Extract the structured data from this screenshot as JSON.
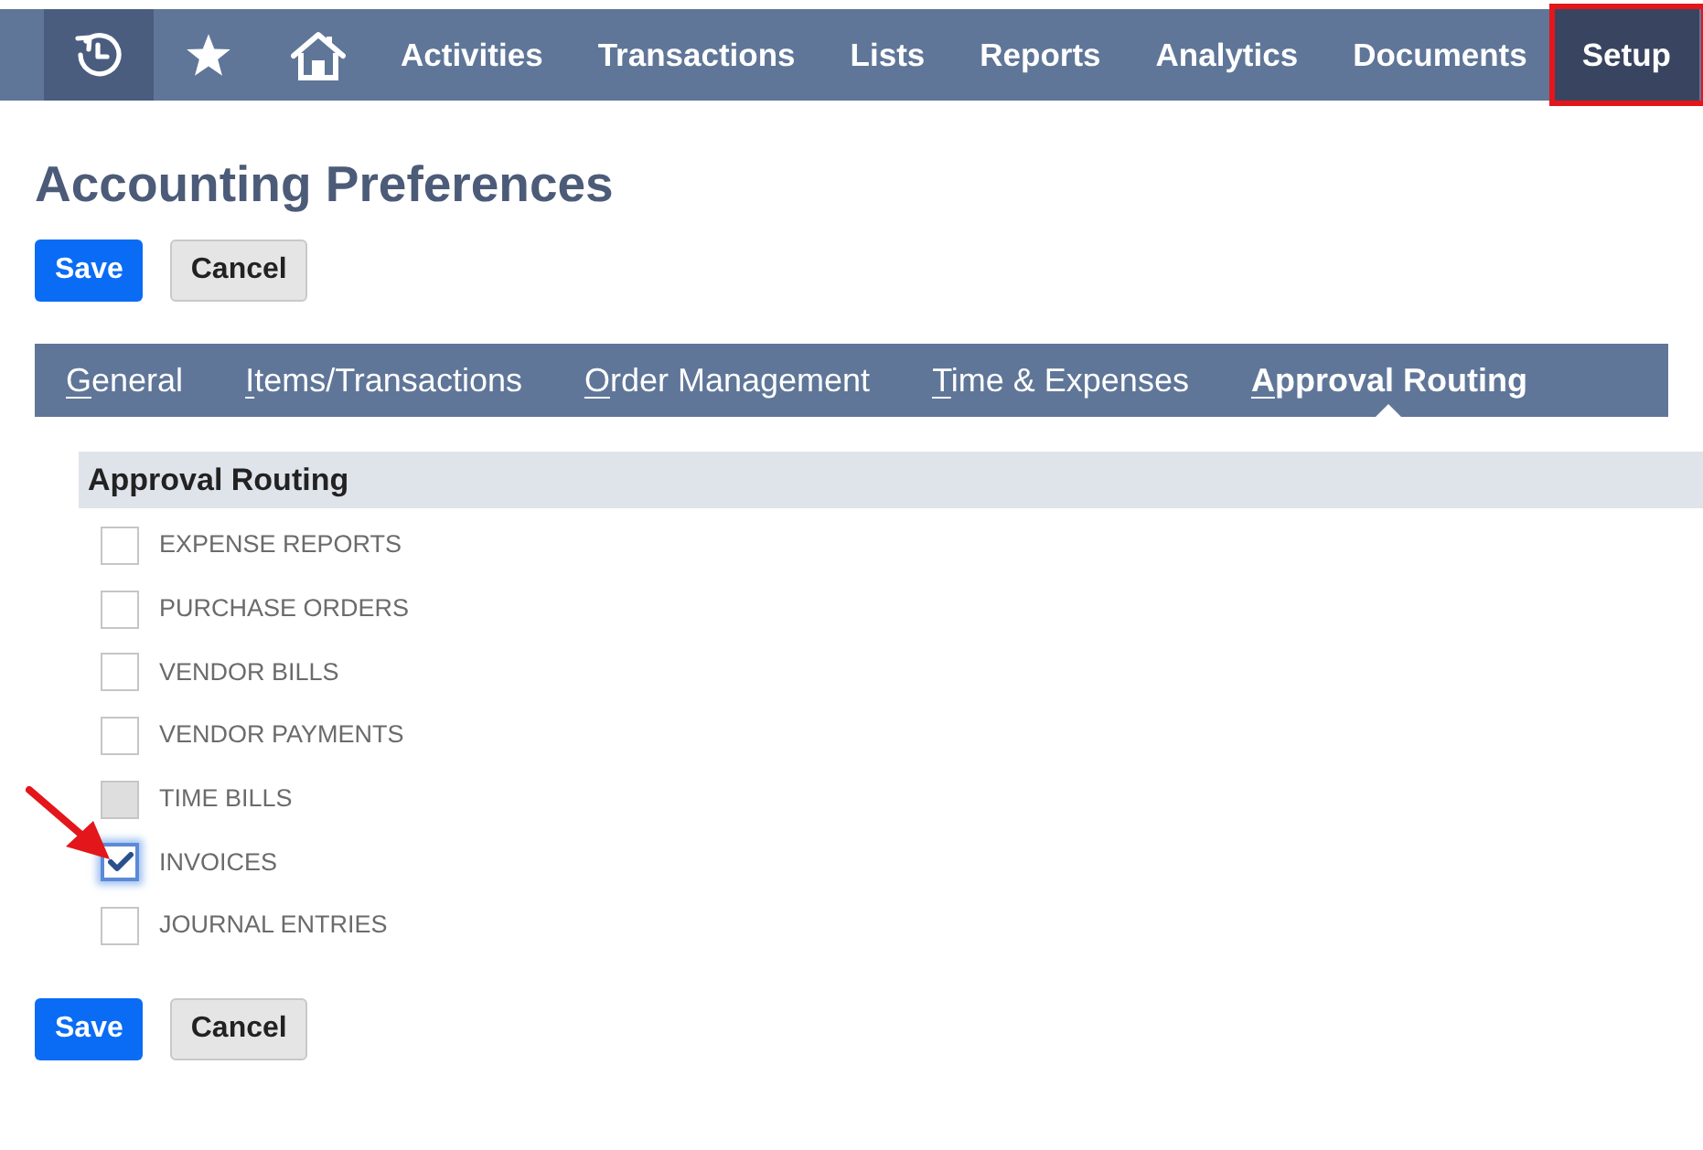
{
  "nav": {
    "items": [
      {
        "label": "Activities",
        "selected": false,
        "highlighted": false
      },
      {
        "label": "Transactions",
        "selected": false,
        "highlighted": false
      },
      {
        "label": "Lists",
        "selected": false,
        "highlighted": false
      },
      {
        "label": "Reports",
        "selected": false,
        "highlighted": false
      },
      {
        "label": "Analytics",
        "selected": false,
        "highlighted": false
      },
      {
        "label": "Documents",
        "selected": false,
        "highlighted": false
      },
      {
        "label": "Setup",
        "selected": true,
        "highlighted": true
      }
    ]
  },
  "page": {
    "title": "Accounting Preferences"
  },
  "top_buttons": [
    {
      "label": "Save",
      "kind": "primary"
    },
    {
      "label": "Cancel",
      "kind": "secondary"
    }
  ],
  "tabs": [
    {
      "label": "General",
      "selected": false
    },
    {
      "label": "Items/Transactions",
      "selected": false
    },
    {
      "label": "Order Management",
      "selected": false
    },
    {
      "label": "Time & Expenses",
      "selected": false
    },
    {
      "label": "Approval Routing",
      "selected": true
    }
  ],
  "section": {
    "title": "Approval Routing",
    "options": [
      {
        "label": "EXPENSE REPORTS",
        "checked": false,
        "disabled": false,
        "focused": false,
        "arrow_marked": false
      },
      {
        "label": "PURCHASE ORDERS",
        "checked": false,
        "disabled": false,
        "focused": false,
        "arrow_marked": false
      },
      {
        "label": "VENDOR BILLS",
        "checked": false,
        "disabled": false,
        "focused": false,
        "arrow_marked": false
      },
      {
        "label": "VENDOR PAYMENTS",
        "checked": false,
        "disabled": false,
        "focused": false,
        "arrow_marked": false
      },
      {
        "label": "TIME BILLS",
        "checked": false,
        "disabled": true,
        "focused": false,
        "arrow_marked": false
      },
      {
        "label": "INVOICES",
        "checked": true,
        "disabled": false,
        "focused": true,
        "arrow_marked": true
      },
      {
        "label": "JOURNAL ENTRIES",
        "checked": false,
        "disabled": false,
        "focused": false,
        "arrow_marked": false
      }
    ]
  },
  "bottom_buttons": [
    {
      "label": "Save",
      "kind": "primary"
    },
    {
      "label": "Cancel",
      "kind": "secondary"
    }
  ]
}
